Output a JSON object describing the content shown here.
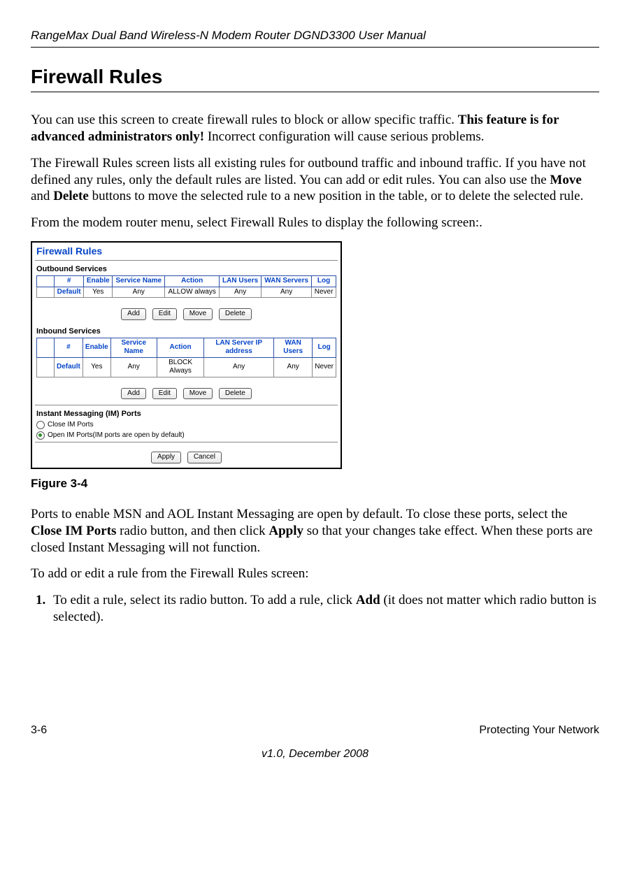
{
  "header": {
    "title": "RangeMax Dual Band Wireless-N Modem Router DGND3300 User Manual"
  },
  "section": {
    "heading": "Firewall Rules"
  },
  "paragraphs": {
    "p1_a": "You can use this screen to create firewall rules to block or allow specific traffic. ",
    "p1_b": "This feature is for advanced administrators only!",
    "p1_c": " Incorrect configuration will cause serious problems.",
    "p2_a": "The Firewall Rules screen lists all existing rules for outbound traffic and inbound traffic. If you have not defined any rules, only the default rules are listed. You can add or edit rules. You can also use the ",
    "p2_b": "Move",
    "p2_c": " and ",
    "p2_d": "Delete",
    "p2_e": " buttons to move the selected rule to a new position in the table, or to delete the selected rule.",
    "p3": "From the modem router menu, select Firewall Rules to display the following screen:.",
    "p4_a": "Ports to enable MSN and AOL Instant Messaging are open by default. To close these ports, select the ",
    "p4_b": "Close IM Ports",
    "p4_c": " radio button, and then click ",
    "p4_d": "Apply",
    "p4_e": " so that your changes take effect. When these ports are closed Instant Messaging will not function.",
    "p5": "To add or edit a rule from the Firewall Rules screen:",
    "step1_a": "To edit a rule, select its radio button. To add a rule, click ",
    "step1_b": "Add",
    "step1_c": " (it does not matter which radio button is selected)."
  },
  "figure": {
    "title": "Firewall Rules",
    "outbound": {
      "heading": "Outbound Services",
      "cols": [
        "",
        "#",
        "Enable",
        "Service Name",
        "Action",
        "LAN Users",
        "WAN Servers",
        "Log"
      ],
      "row": [
        "",
        "Default",
        "Yes",
        "Any",
        "ALLOW always",
        "Any",
        "Any",
        "Never"
      ]
    },
    "inbound": {
      "heading": "Inbound Services",
      "cols": [
        "",
        "#",
        "Enable",
        "Service Name",
        "Action",
        "LAN Server IP address",
        "WAN Users",
        "Log"
      ],
      "row": [
        "",
        "Default",
        "Yes",
        "Any",
        "BLOCK Always",
        "Any",
        "Any",
        "Never"
      ]
    },
    "buttons": {
      "add": "Add",
      "edit": "Edit",
      "move": "Move",
      "delete": "Delete",
      "apply": "Apply",
      "cancel": "Cancel"
    },
    "im": {
      "heading": "Instant Messaging (IM) Ports",
      "close": "Close IM Ports",
      "open": "Open IM Ports(IM ports are open by default)"
    },
    "caption": "Figure 3-4"
  },
  "footer": {
    "page": "3-6",
    "chapter": "Protecting Your Network",
    "version": "v1.0, December 2008"
  }
}
